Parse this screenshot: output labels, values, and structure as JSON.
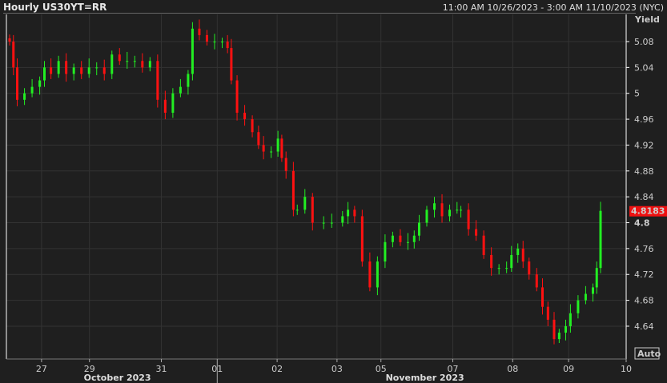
{
  "header": {
    "title": "Hourly US30YT=RR",
    "range": "11:00 AM 10/26/2023 - 3:00 AM 11/10/2023 (NYC)"
  },
  "auto_label": "Auto",
  "colors": {
    "up": "#22ee22",
    "down": "#ff1111",
    "last_price_bg": "#ee1111",
    "grid": "#333333",
    "axis": "#ffffff"
  },
  "chart_data": {
    "type": "candlestick",
    "title": "Hourly US30YT=RR",
    "ylabel": "Yield",
    "ylim": [
      4.615,
      5.11
    ],
    "yticks": [
      5.08,
      5.04,
      5,
      4.96,
      4.92,
      4.88,
      4.84,
      4.8,
      4.76,
      4.72,
      4.68,
      4.64
    ],
    "ytick_labels": [
      "5.08",
      "5.04",
      "5",
      "4.96",
      "4.92",
      "4.88",
      "4.84",
      "4.8",
      "4.76",
      "4.72",
      "4.68",
      "4.64"
    ],
    "last_value": "4.8183",
    "xticks": [
      {
        "bar": 8,
        "label": "27"
      },
      {
        "bar": 20,
        "label": "29"
      },
      {
        "bar": 38,
        "label": "31"
      },
      {
        "bar": 52,
        "label": "01"
      },
      {
        "bar": 67,
        "label": "02"
      },
      {
        "bar": 82,
        "label": "03"
      },
      {
        "bar": 93,
        "label": "05"
      },
      {
        "bar": 111,
        "label": "07"
      },
      {
        "bar": 126,
        "label": "08"
      },
      {
        "bar": 140,
        "label": "09"
      },
      {
        "bar": 155,
        "label": "10"
      }
    ],
    "months": [
      {
        "bar": 27,
        "label": "October 2023"
      },
      {
        "bar": 104,
        "label": "November 2023"
      }
    ],
    "month_divider_bar": 52,
    "bars": [
      0,
      1,
      2,
      4,
      6,
      8,
      9,
      11,
      13,
      15,
      17,
      19,
      21,
      23,
      25,
      27,
      29,
      31,
      33,
      35,
      37,
      39,
      41,
      43,
      45,
      46,
      48,
      50,
      52,
      54,
      55,
      56,
      58,
      60,
      62,
      63,
      65,
      67,
      68,
      69,
      71,
      72,
      74,
      76,
      79,
      81,
      84,
      85,
      87,
      89,
      91,
      93,
      95,
      97,
      99,
      101,
      102,
      104,
      106,
      108,
      110,
      112,
      113,
      115,
      117,
      119,
      121,
      123,
      125,
      126,
      128,
      129,
      131,
      133,
      134,
      136,
      137,
      139,
      140,
      142,
      144,
      146,
      147,
      148
    ],
    "close": [
      5.08,
      5.04,
      4.99,
      5.0,
      5.01,
      5.02,
      5.04,
      5.03,
      5.05,
      5.03,
      5.04,
      5.03,
      5.04,
      5.04,
      5.03,
      5.06,
      5.05,
      5.05,
      5.05,
      5.04,
      5.05,
      4.99,
      4.97,
      5.0,
      5.01,
      5.03,
      5.1,
      5.09,
      5.08,
      5.08,
      5.08,
      5.07,
      5.02,
      4.97,
      4.96,
      4.94,
      4.92,
      4.91,
      4.91,
      4.93,
      4.9,
      4.88,
      4.82,
      4.82,
      4.84,
      4.8,
      4.8,
      4.8,
      4.81,
      4.82,
      4.81,
      4.74,
      4.7,
      4.74,
      4.77,
      4.78,
      4.77,
      4.77,
      4.78,
      4.8,
      4.82,
      4.83,
      4.81,
      4.82,
      4.82,
      4.82,
      4.79,
      4.78,
      4.75,
      4.73,
      4.73,
      4.73,
      4.75,
      4.76,
      4.74,
      4.72,
      4.7,
      4.67,
      4.65,
      4.62,
      4.63,
      4.64,
      4.66,
      4.68,
      4.69,
      4.7,
      4.73,
      4.8183
    ]
  }
}
